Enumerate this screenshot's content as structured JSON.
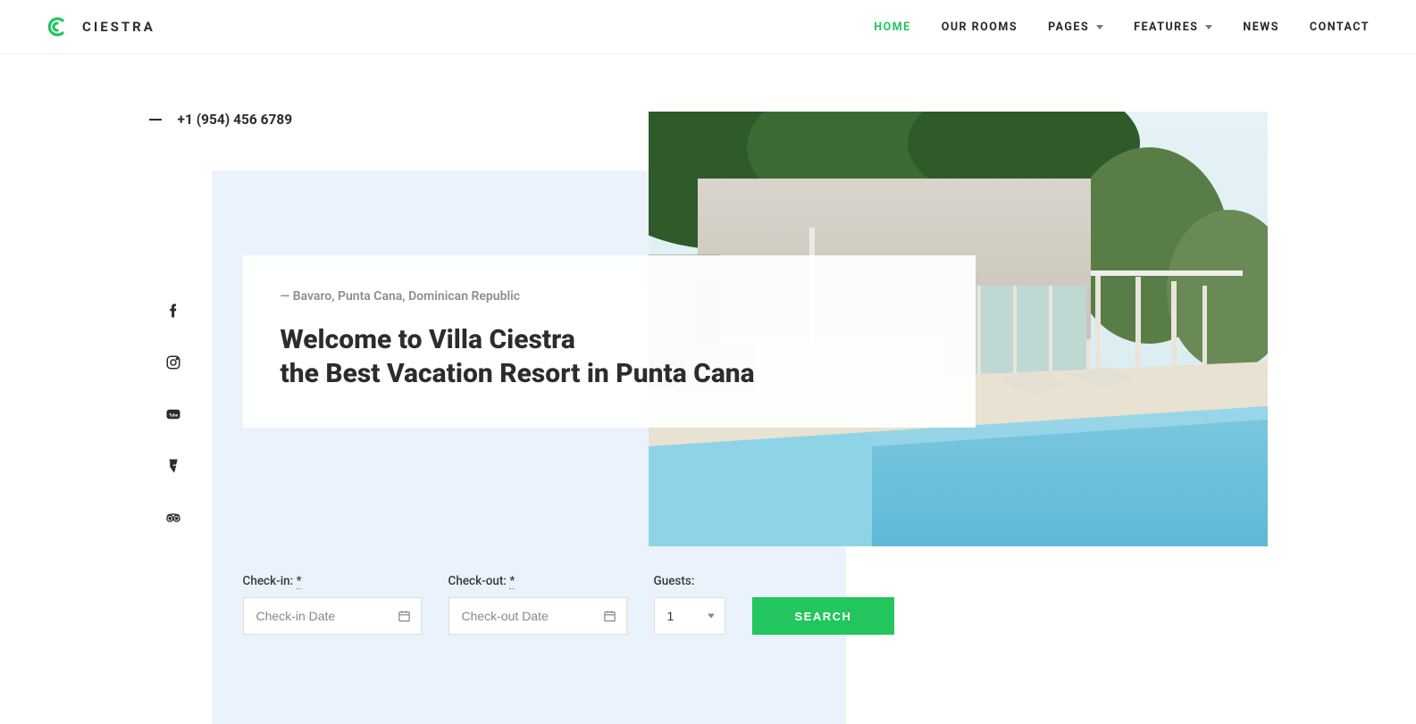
{
  "brand": {
    "name": "CIESTRA",
    "accent": "#22c55e"
  },
  "nav": {
    "items": [
      {
        "label": "HOME",
        "active": true,
        "dropdown": false
      },
      {
        "label": "OUR ROOMS",
        "active": false,
        "dropdown": false
      },
      {
        "label": "PAGES",
        "active": false,
        "dropdown": true
      },
      {
        "label": "FEATURES",
        "active": false,
        "dropdown": true
      },
      {
        "label": "NEWS",
        "active": false,
        "dropdown": false
      },
      {
        "label": "CONTACT",
        "active": false,
        "dropdown": false
      }
    ]
  },
  "phone": "+1 (954) 456 6789",
  "hero": {
    "subtitle": "— Bavaro, Punta Cana, Dominican Republic",
    "title_line1": "Welcome to Villa Ciestra",
    "title_line2": "the Best Vacation Resort in Punta Cana"
  },
  "social": [
    {
      "name": "facebook"
    },
    {
      "name": "instagram"
    },
    {
      "name": "youtube"
    },
    {
      "name": "foursquare"
    },
    {
      "name": "tripadvisor"
    }
  ],
  "search": {
    "checkin_label": "Check-in:",
    "checkin_required": "*",
    "checkin_placeholder": "Check-in Date",
    "checkout_label": "Check-out:",
    "checkout_required": "*",
    "checkout_placeholder": "Check-out Date",
    "guests_label": "Guests:",
    "guests_value": "1",
    "button": "SEARCH"
  }
}
